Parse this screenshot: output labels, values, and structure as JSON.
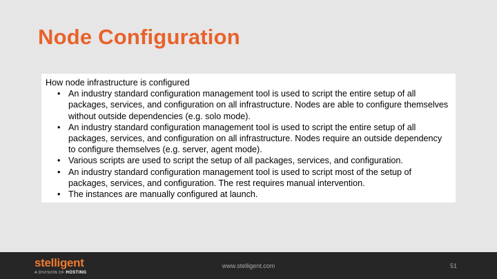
{
  "slide": {
    "title": "Node Configuration",
    "heading": "How node infrastructure is configured",
    "bullets": [
      "An industry standard configuration management tool is used to script the entire setup of all packages, services, and configuration on all infrastructure. Nodes are able to configure themselves without outside dependencies (e.g. solo mode).",
      "An industry standard configuration management tool is used to script the entire setup of all packages, services, and configuration on all infrastructure. Nodes require an outside dependency to configure themselves (e.g. server, agent mode).",
      "Various scripts are used to script the setup of all packages, services, and configuration.",
      "An industry standard configuration management tool is used to script most of the setup of packages, services, and configuration. The rest requires manual intervention.",
      "The instances are manually configured at launch."
    ],
    "bullet_symbol": "•"
  },
  "footer": {
    "logo": "stelligent",
    "logo_tagline_prefix": "A DIVISION OF",
    "logo_tagline_brand": "HOSTING",
    "url": "www.stelligent.com",
    "page_number": "51"
  },
  "colors": {
    "title": "#e8622a",
    "background": "#e6e6e6",
    "footer": "#262626",
    "logo": "#f07a2e"
  }
}
